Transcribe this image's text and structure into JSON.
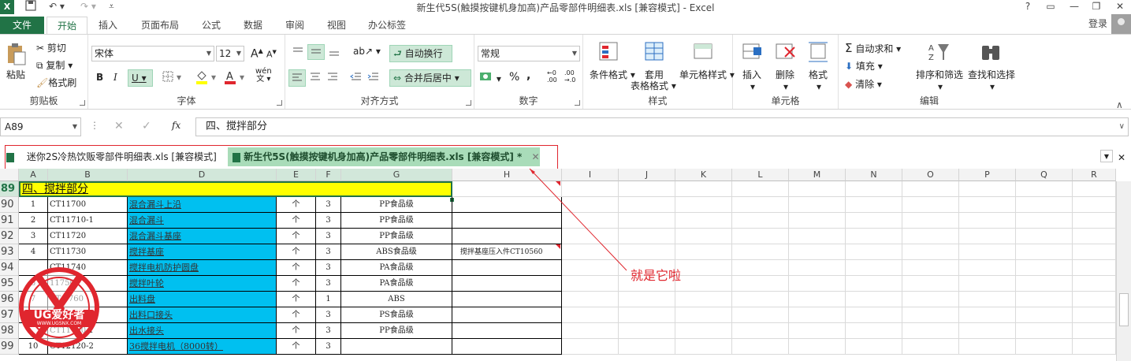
{
  "window": {
    "title": "新生代5S(触摸按键机身加高)产品零部件明细表.xls  [兼容模式] - Excel",
    "app_icon": "X",
    "controls": [
      "?",
      "▭",
      "—",
      "❐",
      "✕"
    ]
  },
  "ribbon_tabs": [
    "文件",
    "开始",
    "插入",
    "页面布局",
    "公式",
    "数据",
    "审阅",
    "视图",
    "办公标签"
  ],
  "login": "登录",
  "ribbon": {
    "clipboard": {
      "label": "剪贴板",
      "paste": "粘贴",
      "cut": "剪切",
      "copy": "复制",
      "painter": "格式刷"
    },
    "font": {
      "label": "字体",
      "name": "宋体",
      "size": "12",
      "grow": "A",
      "shrink": "A",
      "bold": "B",
      "italic": "I",
      "underline": "U",
      "wen": "wén"
    },
    "alignment": {
      "label": "对齐方式",
      "wrap": "自动换行",
      "merge": "合并后居中"
    },
    "number": {
      "label": "数字",
      "format": "常规",
      "percent": "%",
      "comma": ","
    },
    "styles": {
      "label": "样式",
      "conditional": "条件格式",
      "table_format_1": "套用",
      "table_format_2": "表格格式",
      "cell_styles": "单元格样式"
    },
    "cells": {
      "label": "单元格",
      "insert": "插入",
      "delete": "删除",
      "format": "格式"
    },
    "editing": {
      "label": "编辑",
      "autosum": "自动求和",
      "fill": "填充",
      "clear": "清除",
      "sort": "排序和筛选",
      "find": "查找和选择"
    }
  },
  "formula_bar": {
    "name_box": "A89",
    "fx": "fx",
    "content": "四、搅拌部分"
  },
  "doc_tabs": [
    {
      "label": "迷你2S冷热饮贩零部件明细表.xls  [兼容模式]"
    },
    {
      "label": "新生代5S(触摸按键机身加高)产品零部件明细表.xls  [兼容模式] *"
    }
  ],
  "columns": [
    "A",
    "B",
    "D",
    "E",
    "F",
    "G",
    "H",
    "I",
    "J",
    "K",
    "L",
    "M",
    "N",
    "O",
    "P",
    "Q",
    "R"
  ],
  "section_row": {
    "row": "89",
    "title": "四、搅拌部分"
  },
  "rows": [
    {
      "row": "90",
      "a": "1",
      "b": "CT11700",
      "d": "混合漏斗上沿",
      "e": "个",
      "f": "3",
      "g": "PP食品级",
      "h": ""
    },
    {
      "row": "91",
      "a": "2",
      "b": "CT11710-1",
      "d": "混合漏斗",
      "e": "个",
      "f": "3",
      "g": "PP食品级",
      "h": ""
    },
    {
      "row": "92",
      "a": "3",
      "b": "CT11720",
      "d": "混合漏斗基座",
      "e": "个",
      "f": "3",
      "g": "PP食品级",
      "h": ""
    },
    {
      "row": "93",
      "a": "4",
      "b": "CT11730",
      "d": "搅拌基座",
      "e": "个",
      "f": "3",
      "g": "ABS食品级",
      "h": "搅拌基座压入件CT10560"
    },
    {
      "row": "94",
      "a": "",
      "b": "CT11740",
      "d": "搅拌电机防护圆盘",
      "e": "个",
      "f": "3",
      "g": "PA食品级",
      "h": ""
    },
    {
      "row": "95",
      "a": "6",
      "b": "11750",
      "d": "搅拌叶轮",
      "e": "个",
      "f": "3",
      "g": "PA食品级",
      "h": ""
    },
    {
      "row": "96",
      "a": "7",
      "b": "CT 1760",
      "d": "出料盘",
      "e": "个",
      "f": "1",
      "g": "ABS",
      "h": ""
    },
    {
      "row": "97",
      "a": "",
      "b": "",
      "d": "出料口接头",
      "e": "个",
      "f": "3",
      "g": "PS食品级",
      "h": ""
    },
    {
      "row": "98",
      "a": "",
      "b": "CT11780-1",
      "d": "出水接头",
      "e": "个",
      "f": "3",
      "g": "PP食品级",
      "h": ""
    },
    {
      "row": "99",
      "a": "10",
      "b": "CT12120-2",
      "d": "36搅拌电机（8000转）",
      "e": "个",
      "f": "3",
      "g": "",
      "h": ""
    }
  ],
  "annotation": "就是它啦",
  "watermark": {
    "line1": "UG爱好者",
    "line2": "WWW.UGSNX.COM"
  },
  "colors": {
    "excel_green": "#217346",
    "section_fill": "#ffff00",
    "name_fill": "#00c0f0",
    "annotation_red": "#e0262e"
  }
}
